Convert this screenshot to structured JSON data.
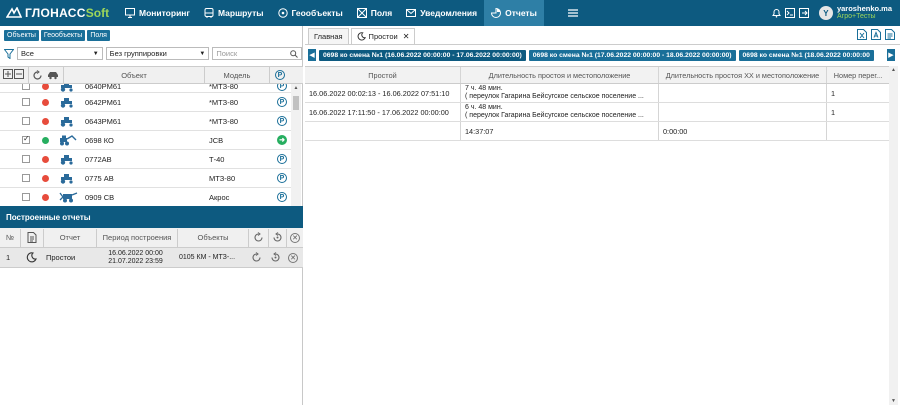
{
  "topbar": {
    "logo_text": "ГЛОНАСС",
    "logo_soft": "Soft",
    "nav": [
      {
        "label": "Мониторинг",
        "icon": "monitor-icon"
      },
      {
        "label": "Маршруты",
        "icon": "bus-icon"
      },
      {
        "label": "Геообъекты",
        "icon": "geo-icon"
      },
      {
        "label": "Поля",
        "icon": "fields-icon"
      },
      {
        "label": "Уведомления",
        "icon": "mail-icon"
      },
      {
        "label": "Отчеты",
        "icon": "reports-icon",
        "active": true
      }
    ],
    "user": {
      "initial": "Y",
      "name": "yaroshenko.ma",
      "company": "Агро+Тесты"
    }
  },
  "left": {
    "tabs": [
      "Объекты",
      "Геообъекты",
      "Поля"
    ],
    "filter_value": "Все",
    "grouping_value": "Без группировки",
    "search_placeholder": "Поиск",
    "columns": {
      "object": "Объект",
      "model": "Модель"
    },
    "objects": [
      {
        "name": "0640РМ61",
        "model": "*МТЗ-80",
        "status": "#e74c3c",
        "checked": false,
        "icon": "tractor-icon"
      },
      {
        "name": "0642РМ61",
        "model": "*МТЗ-80",
        "status": "#e74c3c",
        "checked": false,
        "icon": "tractor-icon"
      },
      {
        "name": "0643РМ61",
        "model": "*МТЗ-80",
        "status": "#e74c3c",
        "checked": false,
        "icon": "tractor-icon"
      },
      {
        "name": "0698 КО",
        "model": "JCB",
        "status": "#27ae60",
        "checked": true,
        "icon": "excavator-icon"
      },
      {
        "name": "0772АВ",
        "model": "Т-40",
        "status": "#e74c3c",
        "checked": false,
        "icon": "tractor-icon"
      },
      {
        "name": "0775 АВ",
        "model": "МТЗ-80",
        "status": "#e74c3c",
        "checked": false,
        "icon": "tractor-icon"
      },
      {
        "name": "0909 СВ",
        "model": "Акрос",
        "status": "#e74c3c",
        "checked": false,
        "icon": "harvester-icon"
      }
    ],
    "reports_title": "Построенные отчеты",
    "report_columns": {
      "num": "№",
      "report": "Отчет",
      "period": "Период построения",
      "objects": "Объекты"
    },
    "reports": [
      {
        "num": "1",
        "name": "Простои",
        "period_from": "16.06.2022 00:00",
        "period_to": "21.07.2022 23:59",
        "objects": "0105 КМ - МТЗ-..."
      }
    ]
  },
  "right": {
    "tabs": [
      {
        "label": "Главная"
      },
      {
        "label": "Простои",
        "active": true
      }
    ],
    "subtabs": [
      "0698 ко смена №1 (16.06.2022 00:00:00 - 17.06.2022 00:00:00)",
      "0698 ко смена №1 (17.06.2022 00:00:00 - 18.06.2022 00:00:00)",
      "0698 ко смена №1 (18.06.2022 00:00:00"
    ],
    "columns": [
      "Простой",
      "Длительность простоя и местоположение",
      "Длительность простоя ХХ и местоположение",
      "Номер перег..."
    ],
    "rows": [
      {
        "period": "16.06.2022 00:02:13 - 16.06.2022 07:51:10",
        "duration": "7 ч. 48 мин.",
        "location": "( переулок Гагарина Бейсугское сельское поселение ...",
        "idle_xx": "",
        "num": "1"
      },
      {
        "period": "16.06.2022 17:11:50 - 17.06.2022 00:00:00",
        "duration": "6 ч. 48 мин.",
        "location": "( переулок Гагарина Бейсугское сельское поселение ...",
        "idle_xx": "",
        "num": "1"
      }
    ],
    "totals": {
      "duration": "14:37:07",
      "idle_xx": "0:00:00"
    }
  }
}
